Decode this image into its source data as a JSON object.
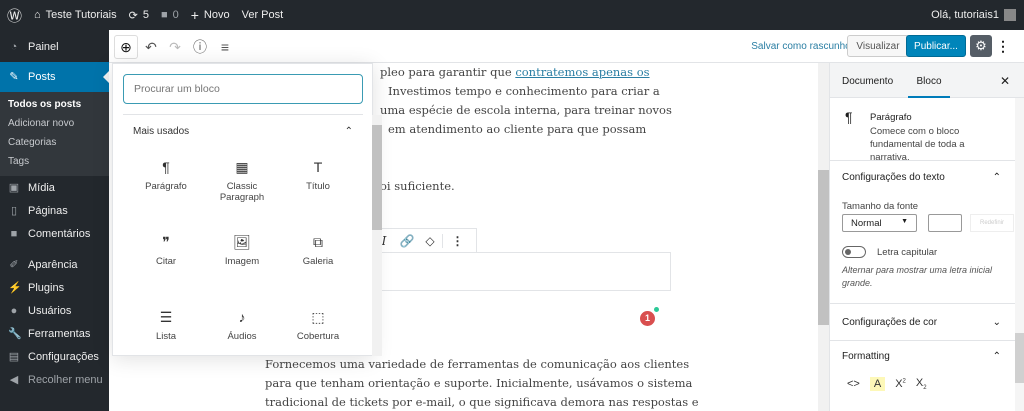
{
  "adminbar": {
    "site": "Teste Tutoriais",
    "updates": "5",
    "comments": "0",
    "new": "Novo",
    "view": "Ver Post",
    "greeting": "Olá, tutoriais1"
  },
  "sidebar": {
    "items": [
      {
        "label": "Painel"
      },
      {
        "label": "Posts"
      },
      {
        "label": "Mídia"
      },
      {
        "label": "Páginas"
      },
      {
        "label": "Comentários"
      },
      {
        "label": "Aparência"
      },
      {
        "label": "Plugins"
      },
      {
        "label": "Usuários"
      },
      {
        "label": "Ferramentas"
      },
      {
        "label": "Configurações"
      },
      {
        "label": "Recolher menu"
      }
    ],
    "submenu": [
      "Todos os posts",
      "Adicionar novo",
      "Categorias",
      "Tags"
    ]
  },
  "header": {
    "save_draft": "Salvar como rascunho",
    "preview": "Visualizar",
    "publish": "Publicar..."
  },
  "content": {
    "lines": [
      "pleo para garantir que ",
      "contratemos apenas os ",
      "Investimos tempo e conhecimento para criar a",
      "uma espécie de escola interna, para treinar novos",
      "em atendimento ao cliente para que possam",
      "oi suficiente."
    ],
    "bottom": [
      "Fornecemos  uma variedade de ferramentas de comunicação aos clientes",
      "para que tenham orientação e suporte. Inicialmente, usávamos o sistema",
      "tradicional de tickets por e-mail, o que significava demora nas respostas e"
    ],
    "badge": "1"
  },
  "inserter": {
    "placeholder": "Procurar um bloco",
    "section": "Mais usados",
    "blocks": [
      {
        "label": "Parágrafo",
        "icon": "¶"
      },
      {
        "label": "Classic Paragraph",
        "icon": "▦"
      },
      {
        "label": "Título",
        "icon": "T"
      },
      {
        "label": "Citar",
        "icon": "❞"
      },
      {
        "label": "Imagem",
        "icon": "🖼"
      },
      {
        "label": "Galeria",
        "icon": "⧉"
      },
      {
        "label": "Lista",
        "icon": "☰"
      },
      {
        "label": "Áudios",
        "icon": "♪"
      },
      {
        "label": "Cobertura",
        "icon": "⬚"
      }
    ]
  },
  "rsidebar": {
    "tabs": [
      "Documento",
      "Bloco"
    ],
    "block_name": "Parágrafo",
    "block_desc": "Comece com o bloco fundamental de toda a narrativa.",
    "text_settings": "Configurações do texto",
    "font_size_label": "Tamanho da fonte",
    "font_size": "Normal",
    "reset": "Redefinir",
    "dropcap": "Letra capitular",
    "dropcap_help": "Alternar para mostrar uma letra inicial grande.",
    "color_settings": "Configurações de cor",
    "formatting": "Formatting"
  }
}
